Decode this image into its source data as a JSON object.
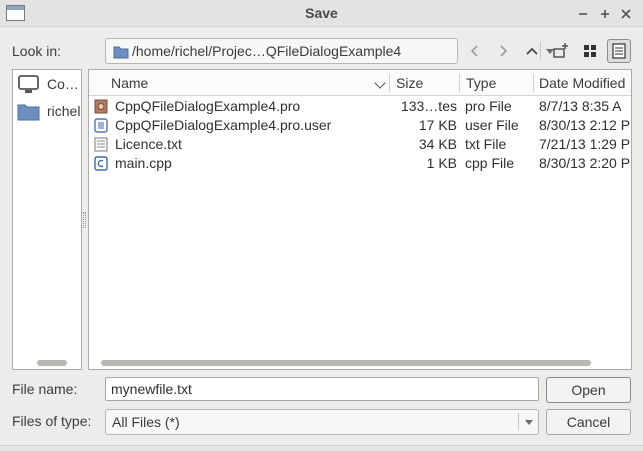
{
  "window": {
    "title": "Save"
  },
  "look_in": {
    "label": "Look in:",
    "path": "/home/richel/Projec…QFileDialogExample4"
  },
  "sidebar": {
    "items": [
      {
        "label": "Co…",
        "icon": "computer-icon"
      },
      {
        "label": "richel",
        "icon": "folder-icon"
      }
    ]
  },
  "file_list": {
    "columns": [
      "Name",
      "Size",
      "Type",
      "Date Modified"
    ],
    "rows": [
      {
        "name": "CppQFileDialogExample4.pro",
        "size": "133…tes",
        "type": "pro File",
        "date": "8/7/13 8:35 A",
        "icon": "qt-project-file-icon"
      },
      {
        "name": "CppQFileDialogExample4.pro.user",
        "size": "17 KB",
        "type": "user File",
        "date": "8/30/13 2:12 P",
        "icon": "xml-file-icon"
      },
      {
        "name": "Licence.txt",
        "size": "34 KB",
        "type": "txt File",
        "date": "7/21/13 1:29 P",
        "icon": "text-file-icon"
      },
      {
        "name": "main.cpp",
        "size": "1 KB",
        "type": "cpp File",
        "date": "8/30/13 2:20 P",
        "icon": "cpp-file-icon"
      }
    ]
  },
  "file_name": {
    "label": "File name:",
    "value": "mynewfile.txt"
  },
  "files_of_type": {
    "label": "Files of type:",
    "value": "All Files (*)"
  },
  "buttons": {
    "open": "Open",
    "cancel": "Cancel"
  },
  "colors": {
    "folder": "#6d8fbd",
    "selection_border": "#8e8d8a"
  }
}
